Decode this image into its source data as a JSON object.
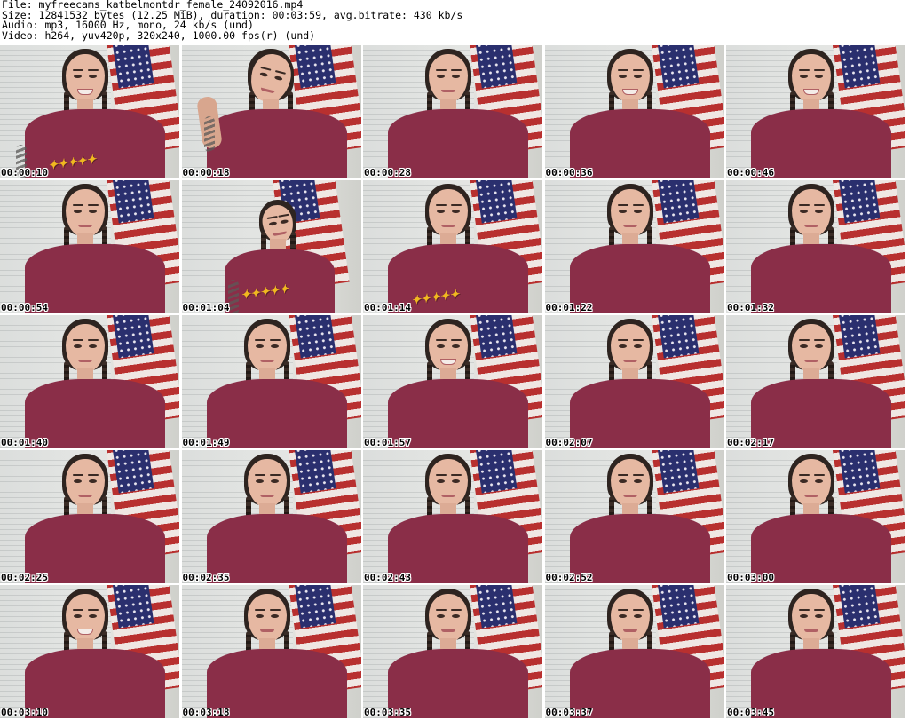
{
  "header": {
    "file": "File: myfreecams_katbelmontdr_female_24092016.mp4",
    "size": "Size: 12841532 bytes (12.25 MiB), duration: 00:03:59, avg.bitrate: 430 kb/s",
    "audio": "Audio: mp3, 16000 Hz, mono, 24 kb/s (und)",
    "video": "Video: h264, yuv420p, 320x240, 1000.00 fps(r) (und)"
  },
  "thumbnails": [
    {
      "time": "00:00:10",
      "pose": "smile-shirt-logo"
    },
    {
      "time": "00:00:18",
      "pose": "tilted-hand-up"
    },
    {
      "time": "00:00:28",
      "pose": "neutral"
    },
    {
      "time": "00:00:36",
      "pose": "smile"
    },
    {
      "time": "00:00:46",
      "pose": "smile"
    },
    {
      "time": "00:00:54",
      "pose": "neutral"
    },
    {
      "time": "00:01:04",
      "pose": "leaning-back-logo"
    },
    {
      "time": "00:01:14",
      "pose": "neutral-logo"
    },
    {
      "time": "00:01:22",
      "pose": "neutral"
    },
    {
      "time": "00:01:32",
      "pose": "neutral"
    },
    {
      "time": "00:01:40",
      "pose": "neutral"
    },
    {
      "time": "00:01:49",
      "pose": "neutral"
    },
    {
      "time": "00:01:57",
      "pose": "smile"
    },
    {
      "time": "00:02:07",
      "pose": "neutral"
    },
    {
      "time": "00:02:17",
      "pose": "neutral"
    },
    {
      "time": "00:02:25",
      "pose": "neutral"
    },
    {
      "time": "00:02:35",
      "pose": "neutral"
    },
    {
      "time": "00:02:43",
      "pose": "neutral"
    },
    {
      "time": "00:02:52",
      "pose": "neutral"
    },
    {
      "time": "00:03:00",
      "pose": "neutral"
    },
    {
      "time": "00:03:10",
      "pose": "smile"
    },
    {
      "time": "00:03:18",
      "pose": "neutral"
    },
    {
      "time": "00:03:35",
      "pose": "neutral"
    },
    {
      "time": "00:03:37",
      "pose": "neutral"
    },
    {
      "time": "00:03:45",
      "pose": "neutral"
    }
  ],
  "colors": {
    "shirt": "#8a2e48",
    "flag_red": "#b8302f",
    "flag_blue": "#2a2f6e",
    "skin": "#e6b8a2",
    "hair": "#2e2420"
  }
}
